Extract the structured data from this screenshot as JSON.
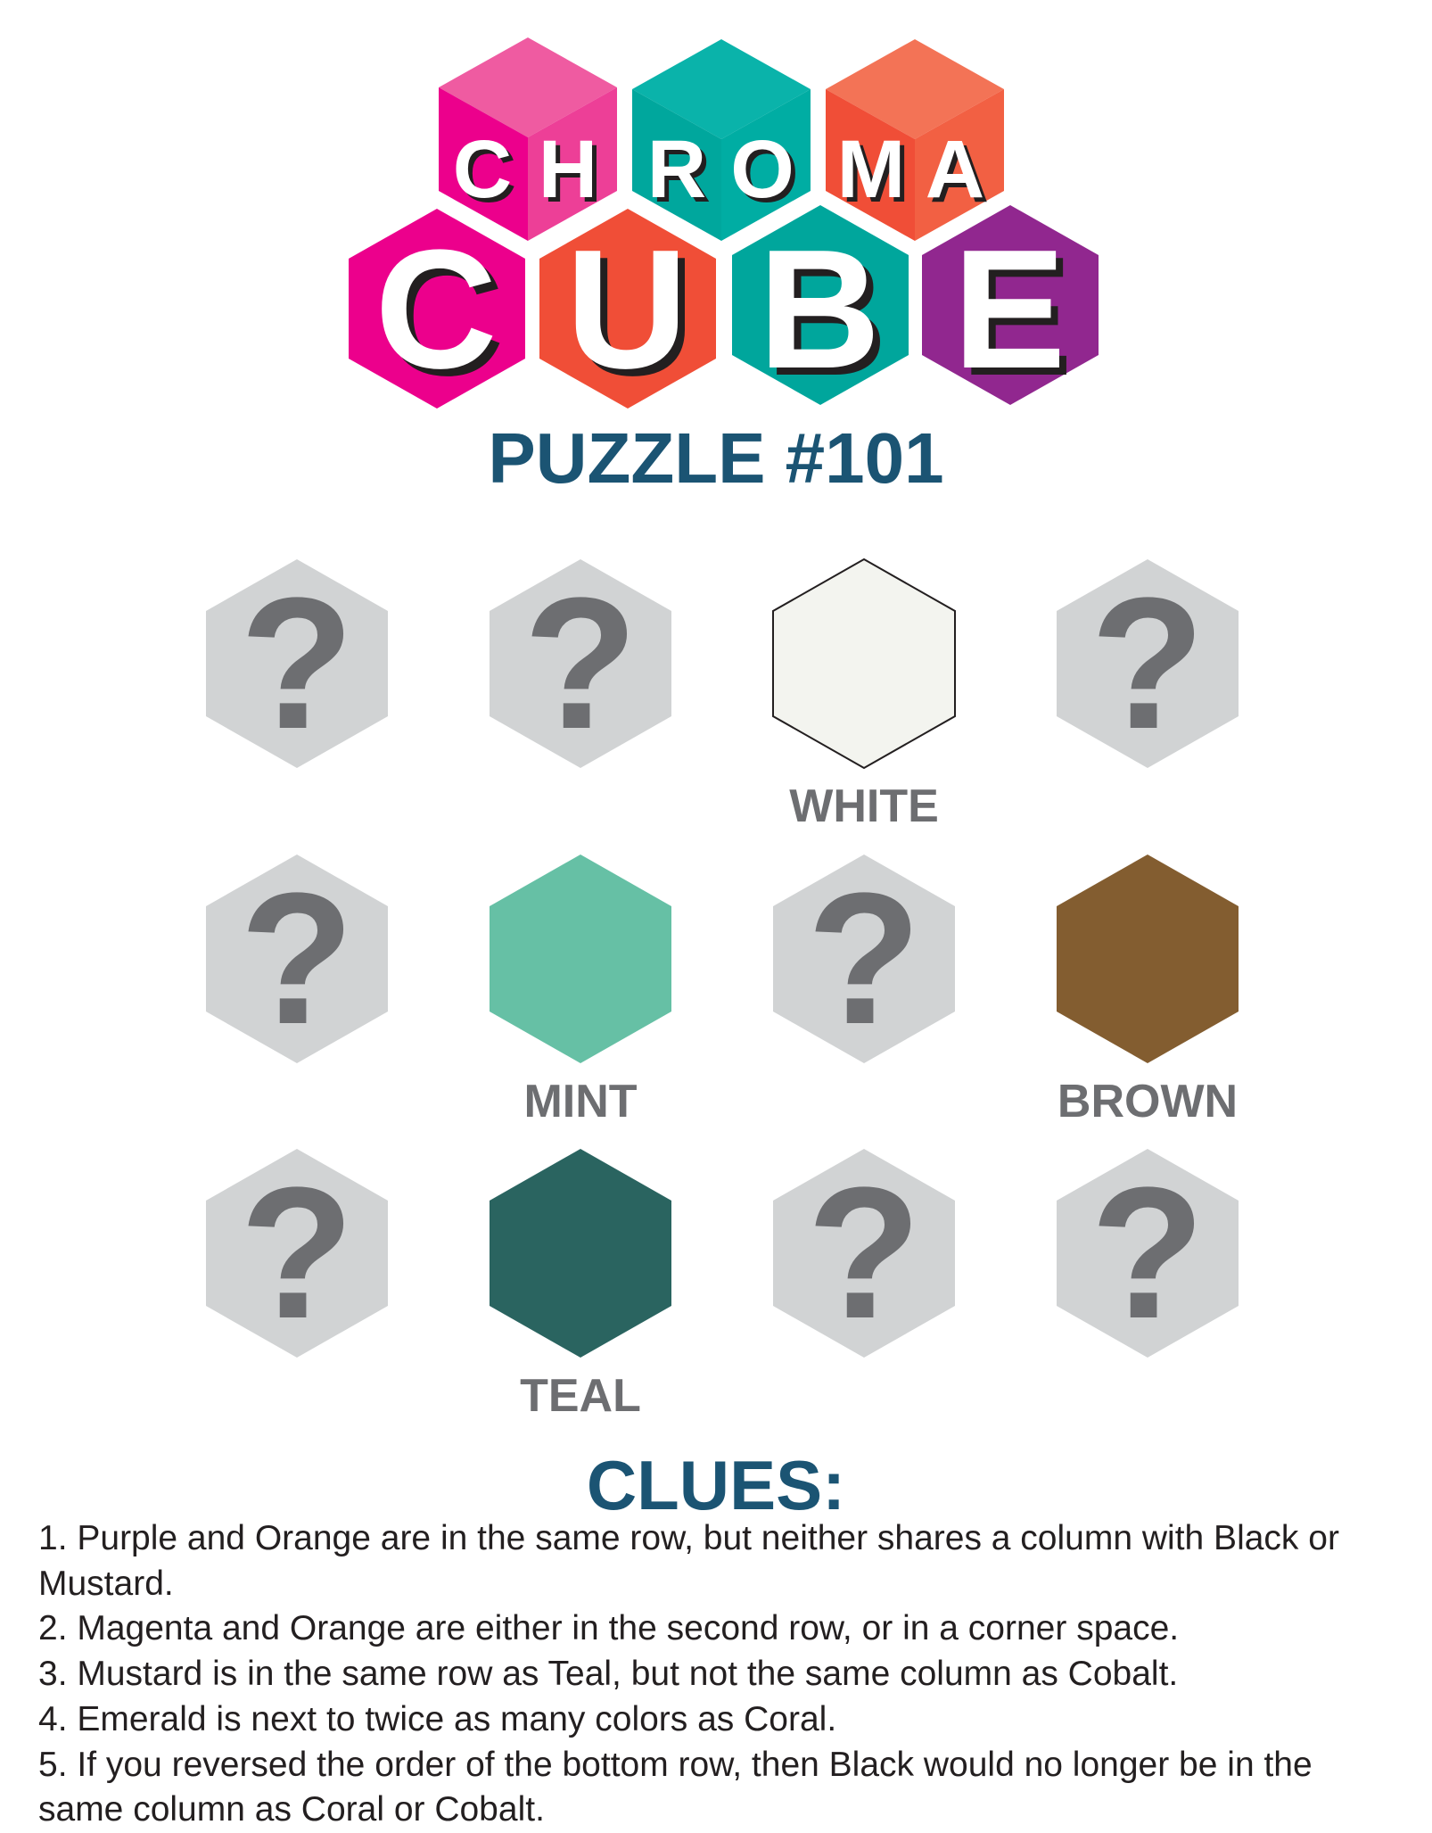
{
  "logo": {
    "line1": [
      "C",
      "H",
      "R",
      "O",
      "M",
      "A"
    ],
    "line2": [
      "C",
      "U",
      "B",
      "E"
    ],
    "text": "CHROMA CUBE"
  },
  "puzzle_title": "PUZZLE #101",
  "colors": {
    "unknown_fill": "#d1d3d4",
    "qmark": "#6d6e71",
    "title": "#1b5473"
  },
  "grid": [
    [
      {
        "known": false,
        "symbol": "?"
      },
      {
        "known": false,
        "symbol": "?"
      },
      {
        "known": true,
        "label": "WHITE",
        "color": "#f3f4ef"
      },
      {
        "known": false,
        "symbol": "?"
      }
    ],
    [
      {
        "known": false,
        "symbol": "?"
      },
      {
        "known": true,
        "label": "MINT",
        "color": "#66c0a5"
      },
      {
        "known": false,
        "symbol": "?"
      },
      {
        "known": true,
        "label": "BROWN",
        "color": "#835d30"
      }
    ],
    [
      {
        "known": false,
        "symbol": "?"
      },
      {
        "known": true,
        "label": "TEAL",
        "color": "#2a6460"
      },
      {
        "known": false,
        "symbol": "?"
      },
      {
        "known": false,
        "symbol": "?"
      }
    ]
  ],
  "clues_heading": "CLUES:",
  "clues": [
    "1. Purple and Orange are in the same row, but neither shares a column with Black or Mustard.",
    "2. Magenta and Orange are either in the second row, or in a corner space.",
    "3. Mustard is in the same row as Teal, but not the same column as Cobalt.",
    "4. Emerald is next to twice as many colors as Coral.",
    "5. If you reversed the order of the bottom row, then Black would no longer be in the same column as Coral or Cobalt."
  ]
}
